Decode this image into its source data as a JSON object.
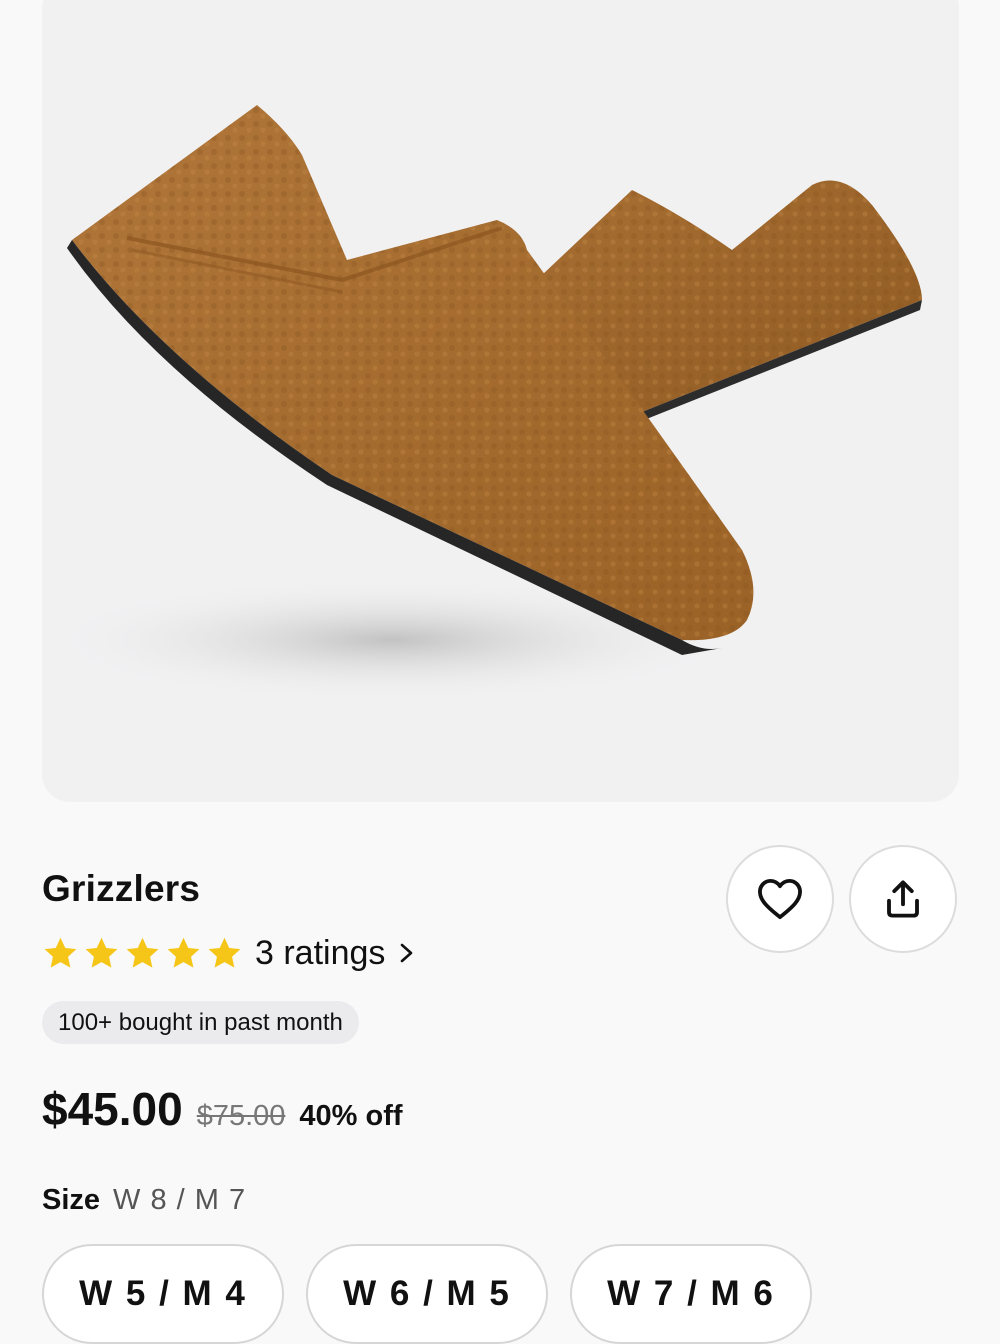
{
  "product": {
    "image_alt": "Brown sherpa slip-on slippers",
    "title": "Grizzlers",
    "rating_stars": 5,
    "ratings_label": "3 ratings",
    "badge": "100+ bought in past month",
    "price": "$45.00",
    "list_price": "$75.00",
    "discount": "40% off",
    "size_label": "Size",
    "size_selected": "W 8 / M 7",
    "size_options": [
      "W 5 / M 4",
      "W 6 / M 5",
      "W 7 / M 6"
    ]
  },
  "actions": {
    "favorite_icon": "heart-icon",
    "share_icon": "share-icon"
  },
  "colors": {
    "star": "#f5c518",
    "slipper": "#a9702e",
    "image_bg": "#f1f1f2"
  }
}
